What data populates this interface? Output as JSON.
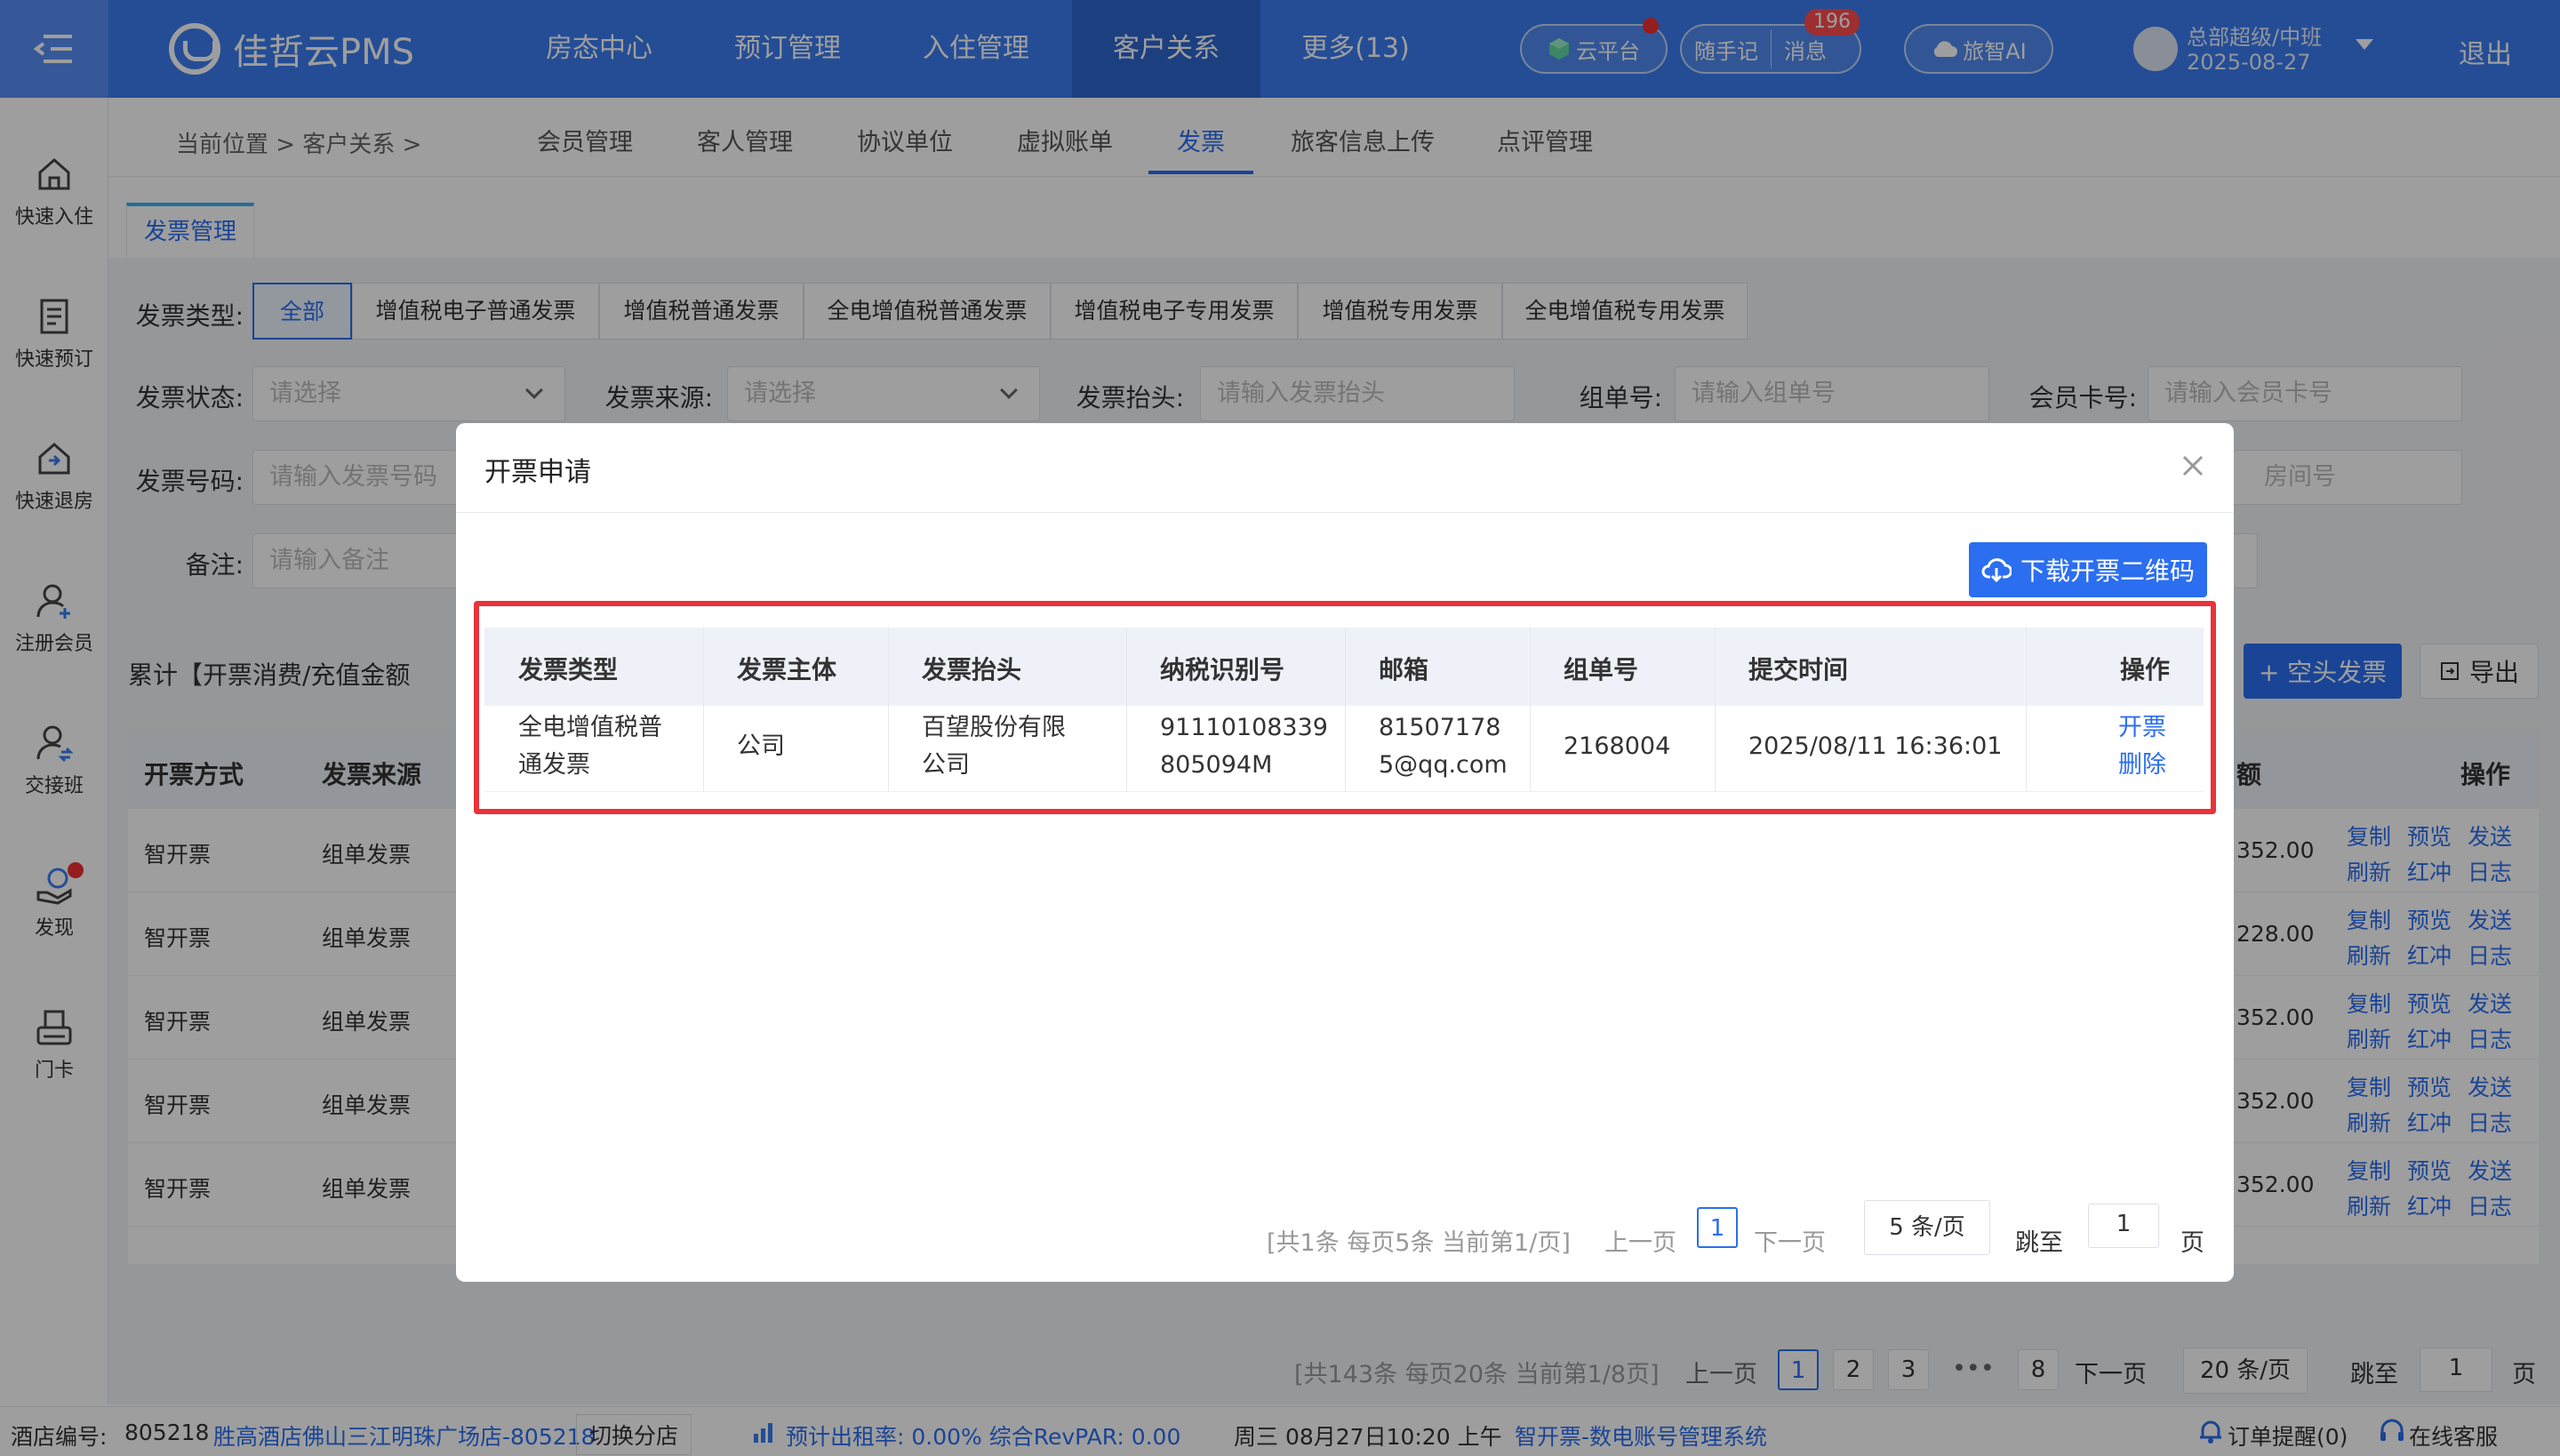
{
  "topbar": {
    "logo_text": "佳哲云PMS",
    "nav": [
      "房态中心",
      "预订管理",
      "入住管理",
      "客户关系",
      "更多(13)"
    ],
    "active_nav": 3,
    "cloud_platform": "云平台",
    "quick_note": "随手记",
    "messages": "消息",
    "message_count": "196",
    "ai_button": "旅智AI",
    "user_name": "总部超级/中班",
    "user_date": "2025-08-27",
    "logout": "退出",
    "accent": "#3b7cf0"
  },
  "sidebar": {
    "items": [
      {
        "label": "快速入住",
        "icon": "home-icon"
      },
      {
        "label": "快速预订",
        "icon": "booking-icon"
      },
      {
        "label": "快速退房",
        "icon": "checkout-icon"
      },
      {
        "label": "注册会员",
        "icon": "register-member-icon"
      },
      {
        "label": "交接班",
        "icon": "shift-handover-icon"
      },
      {
        "label": "发现",
        "icon": "discover-icon"
      },
      {
        "label": "门卡",
        "icon": "door-card-icon"
      }
    ]
  },
  "breadcrumb": {
    "text": "当前位置 > 客户关系 >"
  },
  "subnav": {
    "items": [
      "会员管理",
      "客人管理",
      "协议单位",
      "虚拟账单",
      "发票",
      "旅客信息上传",
      "点评管理"
    ],
    "active": 4
  },
  "tab": {
    "label": "发票管理"
  },
  "filters": {
    "type_label": "发票类型:",
    "types": [
      "全部",
      "增值税电子普通发票",
      "增值税普通发票",
      "全电增值税普通发票",
      "增值税电子专用发票",
      "增值税专用发票",
      "全电增值税专用发票"
    ],
    "status_label": "发票状态:",
    "status_placeholder": "请选择",
    "source_label": "发票来源:",
    "source_placeholder": "请选择",
    "title_label": "发票抬头:",
    "title_placeholder": "请输入发票抬头",
    "group_label": "组单号:",
    "group_placeholder": "请输入组单号",
    "member_label": "会员卡号:",
    "member_placeholder": "请输入会员卡号",
    "number_label": "发票号码:",
    "number_placeholder": "请输入发票号码",
    "room_placeholder": "房间号",
    "remark_label": "备注:",
    "remark_placeholder": "请输入备注"
  },
  "stats": {
    "label": "累计【开票消费/充值金额"
  },
  "actions": {
    "blank_invoice": "+ 空头发票",
    "export": "导出"
  },
  "main_table": {
    "headers": [
      "开票方式",
      "发票来源"
    ],
    "amount_header": "额",
    "ops_header": "操作",
    "rows": [
      {
        "method": "智开票",
        "source": "组单发票",
        "amount": "352.00"
      },
      {
        "method": "智开票",
        "source": "组单发票",
        "amount": "228.00"
      },
      {
        "method": "智开票",
        "source": "组单发票",
        "amount": "352.00"
      },
      {
        "method": "智开票",
        "source": "组单发票",
        "amount": "352.00"
      },
      {
        "method": "智开票",
        "source": "组单发票",
        "amount": "352.00"
      }
    ],
    "row_ops_top": [
      "复制",
      "预览",
      "发送"
    ],
    "row_ops_bottom": [
      "刷新",
      "红冲",
      "日志"
    ]
  },
  "main_pager": {
    "summary": "[共143条 每页20条 当前第1/8页]",
    "prev": "上一页",
    "pages": [
      "1",
      "2",
      "3",
      "8"
    ],
    "ellipsis": "•••",
    "next": "下一页",
    "per_page": "20 条/页",
    "jump_label": "跳至",
    "jump_value": "1",
    "page_unit": "页"
  },
  "footer": {
    "hotel_no_label": "酒店编号:",
    "hotel_no": "805218",
    "hotel_name": "胜高酒店佛山三江明珠广场店-805218",
    "switch_branch": "切换分店",
    "occupancy": "预计出租率: 0.00% 综合RevPAR: 0.00",
    "datetime": "周三 08月27日10:20 上午",
    "system": "智开票-数电账号管理系统",
    "order_reminder": "订单提醒(0)",
    "online_service": "在线客服"
  },
  "modal": {
    "title": "开票申请",
    "download_button": "下载开票二维码",
    "headers": [
      "发票类型",
      "发票主体",
      "发票抬头",
      "纳税识别号",
      "邮箱",
      "组单号",
      "提交时间",
      "操作"
    ],
    "row": {
      "type_line1": "全电增值税普",
      "type_line2": "通发票",
      "entity": "公司",
      "title_line1": "百望股份有限",
      "title_line2": "公司",
      "tax_line1": "91110108339",
      "tax_line2": "805094M",
      "email_line1": "81507178",
      "email_line2": "5@qq.com",
      "group_no": "2168004",
      "submit_time": "2025/08/11 16:36:01",
      "op_issue": "开票",
      "op_delete": "删除"
    },
    "pager": {
      "summary": "[共1条 每页5条 当前第1/页]",
      "prev": "上一页",
      "page": "1",
      "next": "下一页",
      "per_page": "5 条/页",
      "jump_label": "跳至",
      "jump_value": "1",
      "page_unit": "页"
    },
    "highlight_color": "#e8333b"
  }
}
